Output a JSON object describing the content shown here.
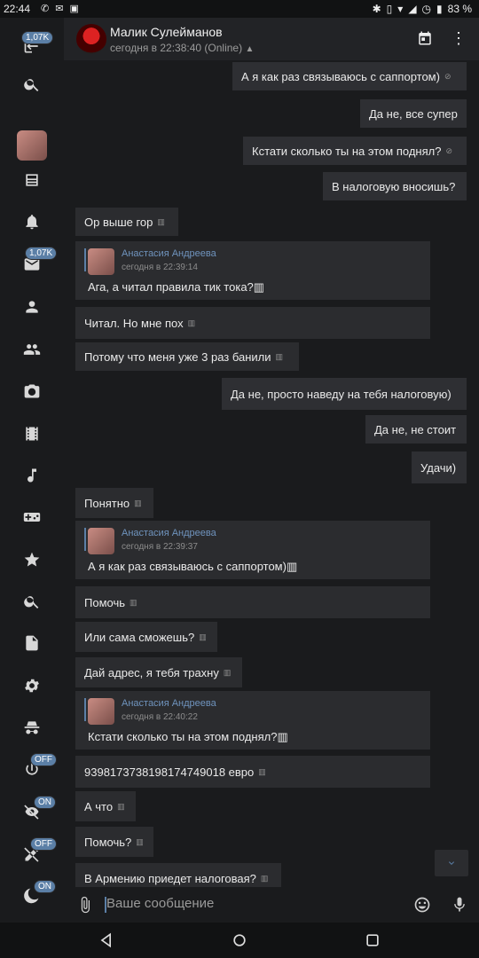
{
  "statusbar": {
    "time": "22:44",
    "battery": "83 %"
  },
  "header": {
    "name": "Малик Сулейманов",
    "status": "сегодня в 22:38:40 (Online)"
  },
  "sidebar": {
    "top_badge": "1,07K",
    "messages_badge": "1,07K",
    "toggle1": "OFF",
    "toggle2": "ON",
    "toggle3": "OFF",
    "toggle4": "ON"
  },
  "messages": [
    {
      "text": "А я как раз связываюсь с саппортом)",
      "dir": "out"
    },
    {
      "text": "Да не, все супер",
      "dir": "out"
    },
    {
      "text": "Кстати сколько ты на этом поднял?",
      "dir": "out"
    },
    {
      "text": "В налоговую вносишь?",
      "dir": "out"
    },
    {
      "text": "Ор выше гор",
      "dir": "in"
    },
    {
      "quote_name": "Анастасия Андреева",
      "quote_time": "сегодня в 22:39:14",
      "text": "Ага, а читал правила тик тока?"
    },
    {
      "text": "Читал. Но мне пох",
      "dir": "in"
    },
    {
      "text": "Потому что меня уже 3 раз банили",
      "dir": "in"
    },
    {
      "text": "Да не, просто наведу на тебя налоговую)",
      "dir": "out"
    },
    {
      "text": "Да не, не стоит",
      "dir": "out"
    },
    {
      "text": "Удачи)",
      "dir": "out"
    },
    {
      "text": "Понятно",
      "dir": "in"
    },
    {
      "quote_name": "Анастасия Андреева",
      "quote_time": "сегодня в 22:39:37",
      "text": "А я как раз связываюсь с саппортом)"
    },
    {
      "text": "Помочь",
      "dir": "in"
    },
    {
      "text": "Или сама сможешь?",
      "dir": "in"
    },
    {
      "text": "Дай адрес, я тебя трахну",
      "dir": "in"
    },
    {
      "quote_name": "Анастасия Андреева",
      "quote_time": "сегодня в 22:40:22",
      "text": "Кстати сколько ты на этом поднял?"
    },
    {
      "text": "939817373819817474​9018 евро",
      "dir": "in"
    },
    {
      "text": "А что",
      "dir": "in"
    },
    {
      "text": "Помочь?",
      "dir": "in"
    },
    {
      "text": "В Армению приедет налоговая?",
      "dir": "in"
    }
  ],
  "input": {
    "placeholder": "Ваше сообщение"
  }
}
